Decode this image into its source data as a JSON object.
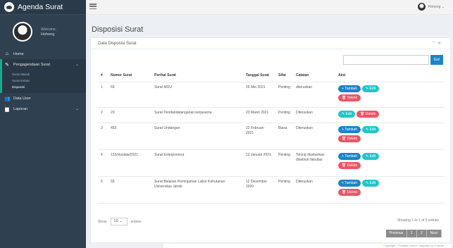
{
  "app": {
    "title": "Agenda Surat"
  },
  "user": {
    "welcome": "Welcome,",
    "name": "Hoheng"
  },
  "sidebar": {
    "items": [
      {
        "label": "Home"
      },
      {
        "label": "Pengagendaan Surat"
      },
      {
        "label": "Data User"
      },
      {
        "label": "Laporan"
      }
    ],
    "submenu": [
      {
        "label": "Surat Masuk"
      },
      {
        "label": "Surat Keluar"
      },
      {
        "label": "Disposisi"
      }
    ]
  },
  "topbar": {
    "user": "Hoheng"
  },
  "page": {
    "title": "Disposisi Surat",
    "panel_title": "Data Disposisi Surat"
  },
  "search": {
    "placeholder": "",
    "go_label": "Go!"
  },
  "table": {
    "headers": [
      "#",
      "Nomor Surat",
      "Perihal Surat",
      "Tanggal Surat",
      "Sifat",
      "Catatan",
      "Aksi"
    ],
    "rows": [
      {
        "no": "1",
        "nomor": "69",
        "perihal": "Surat MOU",
        "tanggal": "26 Mei 2021",
        "sifat": "Penting",
        "catatan": "diteruskan"
      },
      {
        "no": "2",
        "nomor": "23",
        "perihal": "Surat Pendandatanganan kerjasama",
        "tanggal": "23 Maret 2021",
        "sifat": "Penting",
        "catatan": "Diteruskan"
      },
      {
        "no": "3",
        "nomor": "453",
        "perihal": "Surat Undangan",
        "tanggal": "22 Februari 2021",
        "sifat": "Biasa",
        "catatan": "Diteruskan"
      },
      {
        "no": "4",
        "nomor": "123/vlustaw/2021",
        "perihal": "Surat Enterpreneur",
        "tanggal": "12 Januari 2021",
        "sifat": "Penting",
        "catatan": "Tolong disebarkan disetiruh fakultas"
      },
      {
        "no": "5",
        "nomor": "55",
        "perihal": "Surat Balasan Peminjaman Labor Kehutanan Universitas Jambi",
        "tanggal": "12 Desember 2020",
        "sifat": "Penting",
        "catatan": "Diteruskan"
      }
    ]
  },
  "actions": {
    "tambah": "+ Tambah",
    "edit": "✎ Edit",
    "delete": "🗑 Delete"
  },
  "footer": {
    "show_label": "Show",
    "entries_label": "entries",
    "page_size": "10",
    "info": "Showing 1 to 1 of 5 entries",
    "prev": "Previous",
    "page1": "1",
    "page2": "2",
    "next": "Next",
    "copyright": "Copyright · Pusdatin Admin Template by Colorlib"
  }
}
